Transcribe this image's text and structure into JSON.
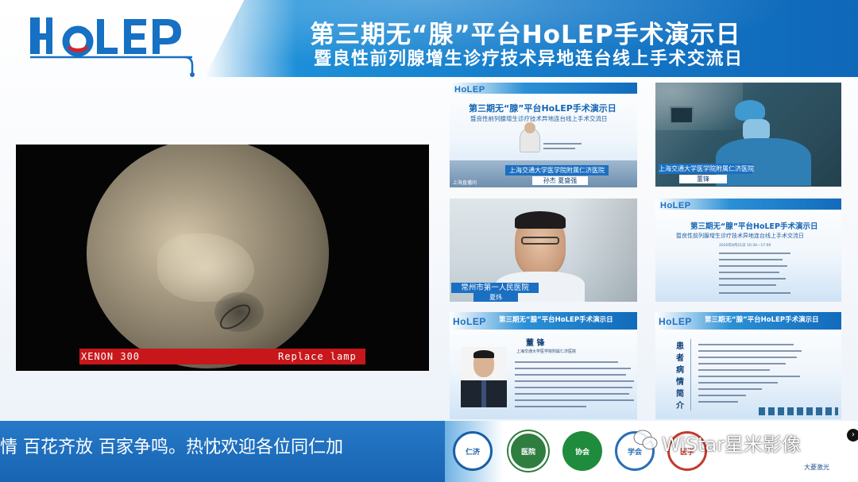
{
  "header": {
    "logo_text": "HoLEP",
    "title_main": "第三期无“腺”平台HoLEP手术演示日",
    "title_sub": "暨良性前列腺增生诊疗技术异地连台线上手术交流日"
  },
  "endoscope": {
    "overlay_left": "XENON 300",
    "overlay_right": "Replace lamp"
  },
  "tiles": {
    "tile1": {
      "mini_logo": "HoLEP",
      "mini_title": "第三期无“腺”平台HoLEP手术演示日",
      "mini_sub": "暨良性前列腺增生诊疗技术异地连台线上手术交流日",
      "banner": "上海交通大学医学院附属仁济医院",
      "name_tag": "孙杰  夏盛强",
      "corner_text": "上海直播间"
    },
    "tile2": {
      "banner": "上海交通大学医学院附属仁济医院",
      "name_tag": "董锋"
    },
    "tile3": {
      "banner": "常州市第一人民医院",
      "name_tag": "夏炜"
    },
    "tile4": {
      "mini_logo": "HoLEP",
      "mini_title": "第三期无“腺”平台HoLEP手术演示日",
      "mini_sub": "暨良性前列腺增生诊疗技术异地连台线上手术交流日",
      "date": "2020年8月21日  10:30—17:00"
    },
    "tile5": {
      "mini_logo": "HoLEP",
      "mini_title": "第三期无“腺”平台HoLEP手术演示日",
      "speaker_name": "董 锋",
      "speaker_org": "上海交通大学医学院附属仁济医院"
    },
    "tile6": {
      "mini_logo": "HoLEP",
      "mini_title": "第三期无“腺”平台HoLEP手术演示日",
      "side_label": "患者病情简介"
    }
  },
  "ticker": {
    "text": "情 百花齐放  百家争鸣。热忱欢迎各位同仁加"
  },
  "watermark": {
    "text": "WiStar星米影像"
  },
  "org_logos": [
    "仁济",
    "医院",
    "协会",
    "学会",
    "医学",
    "大菱激光"
  ],
  "colors": {
    "brand_blue": "#1479c8",
    "banner_blue": "#1b6fc1",
    "alert_red": "#c8171a"
  }
}
